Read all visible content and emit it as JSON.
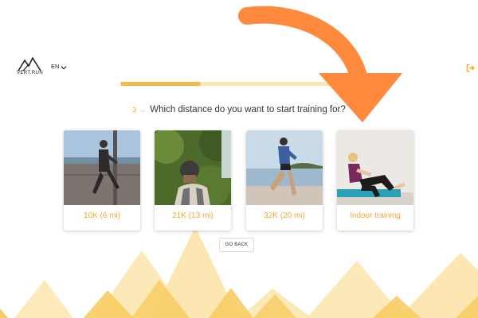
{
  "header": {
    "logo_text": "VERT.RUN",
    "language": "EN"
  },
  "progress": {
    "fraction": 0.34
  },
  "question": {
    "step_number": "3",
    "text": "Which distance do you want to start training for?"
  },
  "options": [
    {
      "label": "10K (6 mi)"
    },
    {
      "label": "21K (13 mi)"
    },
    {
      "label": "32K (20 mi)"
    },
    {
      "label": "Indoor training"
    }
  ],
  "footer": {
    "go_back_label": "GO BACK"
  },
  "colors": {
    "accent": "#f5b84a",
    "accent_light": "#fbe6b8",
    "label": "#f0a93a",
    "arrow": "#ff8a3d",
    "mountain_dark": "#f7cc63",
    "mountain_light": "#fbe3a6"
  },
  "icons": {
    "logo": "mountain-logo-icon",
    "language_toggle": "chevron-down-icon",
    "logout": "logout-icon",
    "step": "arrow-right-icon"
  }
}
